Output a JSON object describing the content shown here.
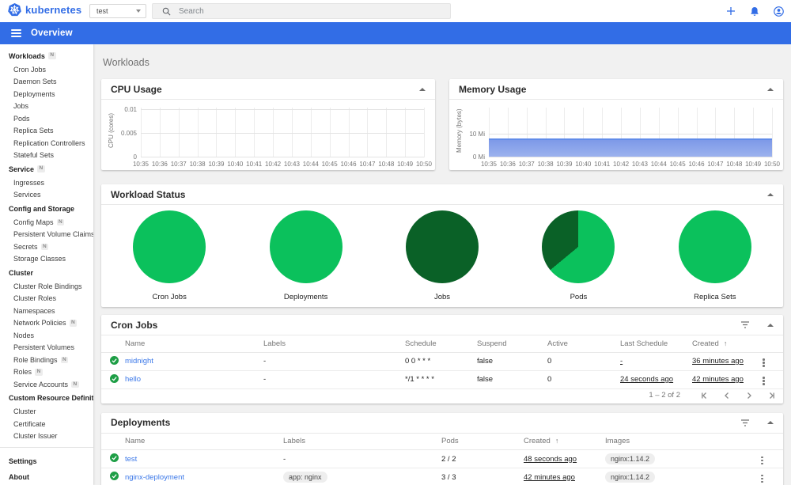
{
  "header": {
    "logo_text": "kubernetes",
    "namespace": "test",
    "search_placeholder": "Search"
  },
  "appbar": {
    "title": "Overview"
  },
  "sidebar": {
    "badge_text": "N",
    "items": [
      {
        "kind": "section",
        "label": "Workloads",
        "badge": true
      },
      {
        "kind": "item",
        "label": "Cron Jobs"
      },
      {
        "kind": "item",
        "label": "Daemon Sets"
      },
      {
        "kind": "item",
        "label": "Deployments"
      },
      {
        "kind": "item",
        "label": "Jobs"
      },
      {
        "kind": "item",
        "label": "Pods"
      },
      {
        "kind": "item",
        "label": "Replica Sets"
      },
      {
        "kind": "item",
        "label": "Replication Controllers"
      },
      {
        "kind": "item",
        "label": "Stateful Sets"
      },
      {
        "kind": "section",
        "label": "Service",
        "badge": true
      },
      {
        "kind": "item",
        "label": "Ingresses"
      },
      {
        "kind": "item",
        "label": "Services"
      },
      {
        "kind": "section",
        "label": "Config and Storage"
      },
      {
        "kind": "item",
        "label": "Config Maps",
        "badge": true
      },
      {
        "kind": "item",
        "label": "Persistent Volume Claims",
        "badge": true
      },
      {
        "kind": "item",
        "label": "Secrets",
        "badge": true
      },
      {
        "kind": "item",
        "label": "Storage Classes"
      },
      {
        "kind": "section",
        "label": "Cluster"
      },
      {
        "kind": "item",
        "label": "Cluster Role Bindings"
      },
      {
        "kind": "item",
        "label": "Cluster Roles"
      },
      {
        "kind": "item",
        "label": "Namespaces"
      },
      {
        "kind": "item",
        "label": "Network Policies",
        "badge": true
      },
      {
        "kind": "item",
        "label": "Nodes"
      },
      {
        "kind": "item",
        "label": "Persistent Volumes"
      },
      {
        "kind": "item",
        "label": "Role Bindings",
        "badge": true
      },
      {
        "kind": "item",
        "label": "Roles",
        "badge": true
      },
      {
        "kind": "item",
        "label": "Service Accounts",
        "badge": true
      },
      {
        "kind": "section",
        "label": "Custom Resource Definitions"
      },
      {
        "kind": "item",
        "label": "Cluster"
      },
      {
        "kind": "item",
        "label": "Certificate"
      },
      {
        "kind": "item",
        "label": "Cluster Issuer"
      },
      {
        "kind": "divider"
      },
      {
        "kind": "top",
        "label": "Settings"
      },
      {
        "kind": "top",
        "label": "About"
      }
    ]
  },
  "main": {
    "page_title": "Workloads"
  },
  "chart_data": {
    "cpu": {
      "type": "line",
      "title": "CPU Usage",
      "ylabel": "CPU (cores)",
      "x_ticks": [
        "10:35",
        "10:36",
        "10:37",
        "10:38",
        "10:39",
        "10:40",
        "10:41",
        "10:42",
        "10:43",
        "10:44",
        "10:45",
        "10:46",
        "10:47",
        "10:48",
        "10:49",
        "10:50"
      ],
      "y_ticks": [
        {
          "value": 0,
          "label": "0"
        },
        {
          "value": 0.005,
          "label": "0.005"
        },
        {
          "value": 0.01,
          "label": "0.01"
        }
      ],
      "ymax": 0.0105,
      "values": []
    },
    "memory": {
      "type": "area",
      "title": "Memory Usage",
      "ylabel": "Memory (bytes)",
      "x_ticks": [
        "10:35",
        "10:36",
        "10:37",
        "10:38",
        "10:39",
        "10:40",
        "10:41",
        "10:42",
        "10:43",
        "10:44",
        "10:45",
        "10:46",
        "10:47",
        "10:48",
        "10:49",
        "10:50"
      ],
      "y_ticks": [
        {
          "value": 0,
          "label": "0 Mi"
        },
        {
          "value": 10,
          "label": "10 Mi"
        }
      ],
      "ymax": 21.4,
      "unit": "Mi",
      "values": [
        8,
        8,
        8,
        8,
        8,
        8,
        8,
        8,
        8,
        8,
        8,
        8,
        8,
        8,
        8,
        8
      ]
    },
    "workload_status": {
      "title": "Workload Status",
      "pies": [
        {
          "label": "Cron Jobs",
          "segments": [
            {
              "color": "#0bc15c",
              "pct": 100
            }
          ]
        },
        {
          "label": "Deployments",
          "segments": [
            {
              "color": "#0bc15c",
              "pct": 100
            }
          ]
        },
        {
          "label": "Jobs",
          "segments": [
            {
              "color": "#0a6127",
              "pct": 100
            }
          ]
        },
        {
          "label": "Pods",
          "segments": [
            {
              "color": "#0bc15c",
              "pct": 64
            },
            {
              "color": "#0a6127",
              "pct": 36
            }
          ]
        },
        {
          "label": "Replica Sets",
          "segments": [
            {
              "color": "#0bc15c",
              "pct": 100
            }
          ]
        }
      ]
    }
  },
  "tables": {
    "cron_jobs": {
      "title": "Cron Jobs",
      "columns": [
        "Name",
        "Labels",
        "Schedule",
        "Suspend",
        "Active",
        "Last Schedule",
        "Created"
      ],
      "sort_column": "Created",
      "sort_glyph": "↑",
      "rows": [
        {
          "name": "midnight",
          "labels": "-",
          "labels_chip": false,
          "schedule": "0 0 * * *",
          "suspend": "false",
          "active": "0",
          "last_schedule": "-",
          "created": "36 minutes ago"
        },
        {
          "name": "hello",
          "labels": "-",
          "labels_chip": false,
          "schedule": "*/1 * * * *",
          "suspend": "false",
          "active": "0",
          "last_schedule": "24 seconds ago",
          "created": "42 minutes ago"
        }
      ],
      "pagination": {
        "range": "1 – 2 of 2"
      }
    },
    "deployments": {
      "title": "Deployments",
      "columns": [
        "Name",
        "Labels",
        "Pods",
        "Created",
        "Images"
      ],
      "sort_column": "Created",
      "sort_glyph": "↑",
      "rows": [
        {
          "name": "test",
          "labels": "-",
          "labels_chip": false,
          "pods": "2 / 2",
          "created": "48 seconds ago",
          "images": "nginx:1.14.2"
        },
        {
          "name": "nginx-deployment",
          "labels": "app: nginx",
          "labels_chip": true,
          "pods": "3 / 3",
          "created": "42 minutes ago",
          "images": "nginx:1.14.2"
        }
      ]
    }
  },
  "icons": {
    "logo": "kubernetes-helm-wheel",
    "search": "magnifier",
    "add": "plus",
    "notifications": "bell",
    "account": "person-circle",
    "menu": "hamburger",
    "collapse": "caret-up",
    "filter": "filter-list",
    "row_menu": "vertical-dots",
    "status_ok": "check-circle",
    "pagination": [
      "first-page",
      "previous-page",
      "next-page",
      "last-page"
    ]
  },
  "colors": {
    "accent": "#326de6",
    "pie_green": "#0bc15c",
    "pie_dark_green": "#0a6127",
    "check_green": "#1e9e46",
    "link": "#3a77e8",
    "area_fill_top": "#7d99e8",
    "main_bg": "#f1f1f1"
  }
}
